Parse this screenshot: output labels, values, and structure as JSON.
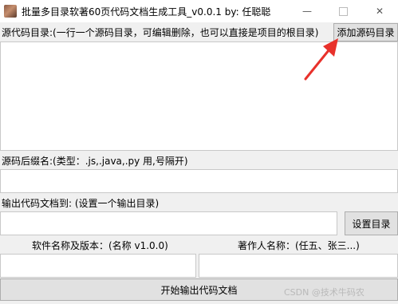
{
  "window": {
    "title": "批量多目录软著60页代码文档生成工具_v0.0.1    by: 任聪聪",
    "minimize_glyph": "—",
    "close_glyph": "✕"
  },
  "source": {
    "label": "源代码目录:(一行一个源码目录，可编辑删除，也可以直接是项目的根目录)",
    "add_button": "添加源码目录",
    "value": ""
  },
  "suffix": {
    "label": "源码后缀名:(类型：.js,.java,.py 用,号隔开)",
    "value": ""
  },
  "output": {
    "label": "输出代码文档到: (设置一个输出目录)",
    "value": "",
    "set_button": "设置目录"
  },
  "software": {
    "label": "软件名称及版本：(名称 v1.0.0)",
    "value": ""
  },
  "author": {
    "label": "著作人名称：(任五、张三...)",
    "value": ""
  },
  "start_button": "开始输出代码文档",
  "watermark": "CSDN @技术牛码农",
  "colors": {
    "annotation_arrow": "#e8312b",
    "window_bg": "#f0f0f0"
  }
}
